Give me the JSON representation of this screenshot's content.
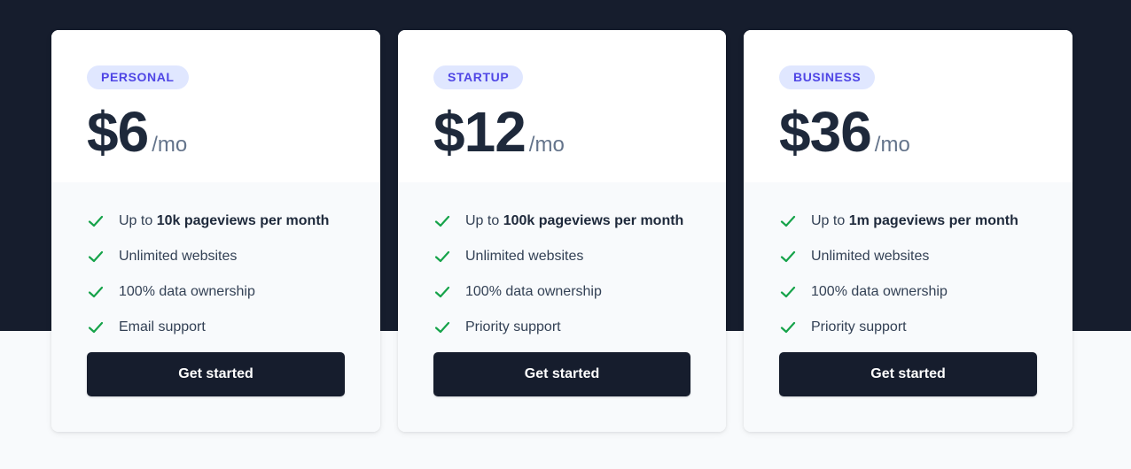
{
  "plans": [
    {
      "badge": "PERSONAL",
      "price": "$6",
      "period": "/mo",
      "features": [
        {
          "prefix": "Up to ",
          "bold": "10k pageviews per month",
          "suffix": ""
        },
        {
          "prefix": "Unlimited websites",
          "bold": "",
          "suffix": ""
        },
        {
          "prefix": "100% data ownership",
          "bold": "",
          "suffix": ""
        },
        {
          "prefix": "Email support",
          "bold": "",
          "suffix": ""
        }
      ],
      "cta": "Get started"
    },
    {
      "badge": "STARTUP",
      "price": "$12",
      "period": "/mo",
      "features": [
        {
          "prefix": "Up to ",
          "bold": "100k pageviews per month",
          "suffix": ""
        },
        {
          "prefix": "Unlimited websites",
          "bold": "",
          "suffix": ""
        },
        {
          "prefix": "100% data ownership",
          "bold": "",
          "suffix": ""
        },
        {
          "prefix": "Priority support",
          "bold": "",
          "suffix": ""
        }
      ],
      "cta": "Get started"
    },
    {
      "badge": "BUSINESS",
      "price": "$36",
      "period": "/mo",
      "features": [
        {
          "prefix": "Up to ",
          "bold": "1m pageviews per month",
          "suffix": ""
        },
        {
          "prefix": "Unlimited websites",
          "bold": "",
          "suffix": ""
        },
        {
          "prefix": "100% data ownership",
          "bold": "",
          "suffix": ""
        },
        {
          "prefix": "Priority support",
          "bold": "",
          "suffix": ""
        }
      ],
      "cta": "Get started"
    }
  ],
  "icons": {
    "feature_check": "check-icon"
  },
  "colors": {
    "dark_background": "#161d2d",
    "light_background": "#f8fafc",
    "badge_background": "#e0e7ff",
    "badge_text": "#4f46e5",
    "check": "#16a34a"
  }
}
